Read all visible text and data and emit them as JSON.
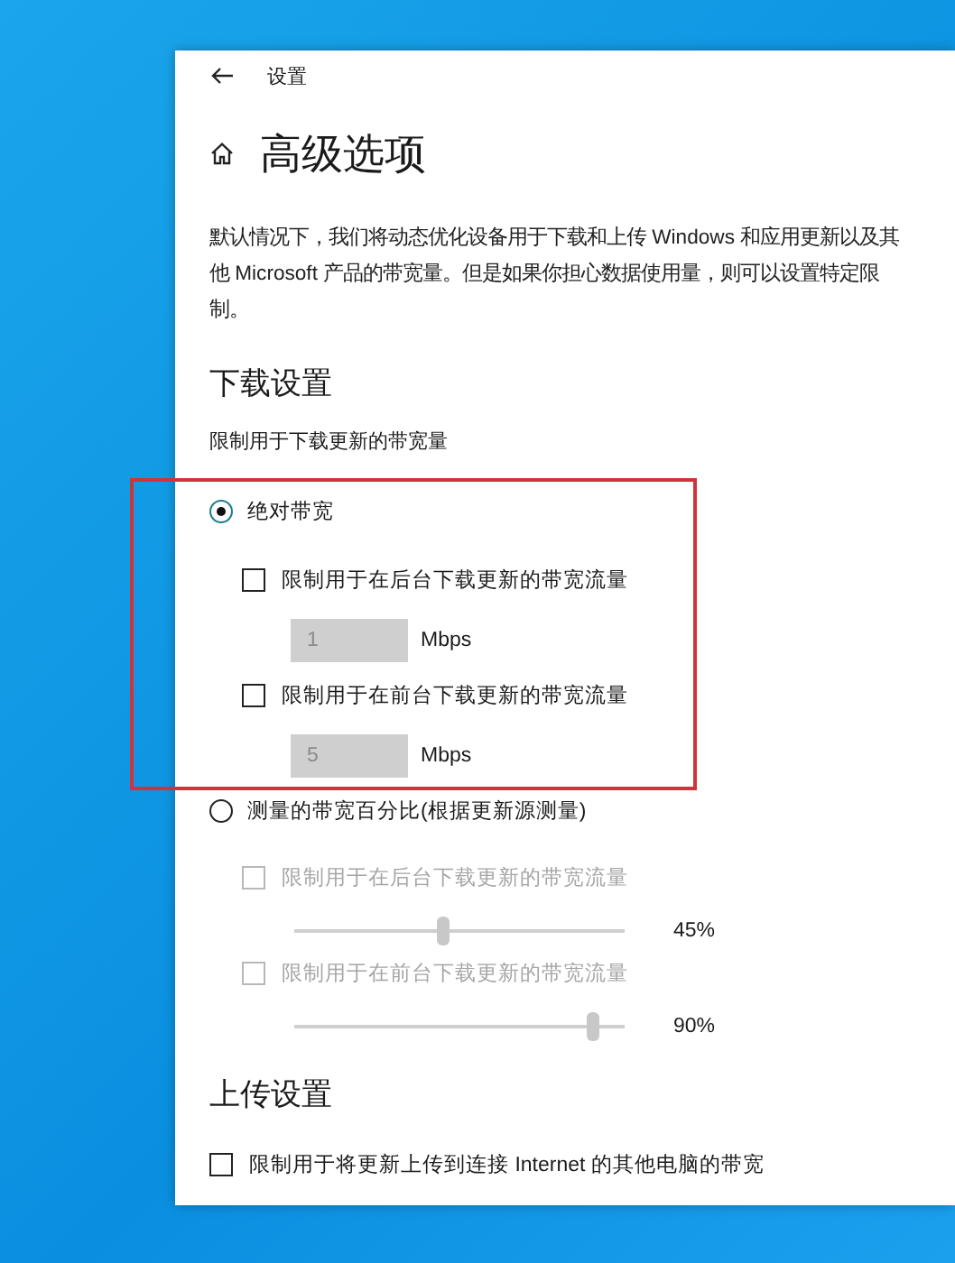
{
  "window": {
    "title": "设置"
  },
  "page": {
    "title": "高级选项",
    "description": "默认情况下，我们将动态优化设备用于下载和上传 Windows 和应用更新以及其他 Microsoft 产品的带宽量。但是如果你担心数据使用量，则可以设置特定限制。"
  },
  "download": {
    "heading": "下载设置",
    "subheading": "限制用于下载更新的带宽量",
    "options": [
      {
        "label": "绝对带宽",
        "selected": true,
        "limits": [
          {
            "kind": "field",
            "label": "限制用于在后台下载更新的带宽流量",
            "checked": false,
            "disabled": false,
            "value": "1",
            "unit": "Mbps"
          },
          {
            "kind": "field",
            "label": "限制用于在前台下载更新的带宽流量",
            "checked": false,
            "disabled": false,
            "value": "5",
            "unit": "Mbps"
          }
        ]
      },
      {
        "label": "测量的带宽百分比(根据更新源测量)",
        "selected": false,
        "limits": [
          {
            "kind": "slider",
            "label": "限制用于在后台下载更新的带宽流量",
            "checked": false,
            "disabled": true,
            "level": 0.45,
            "reading": "45%"
          },
          {
            "kind": "slider",
            "label": "限制用于在前台下载更新的带宽流量",
            "checked": false,
            "disabled": true,
            "level": 0.9,
            "reading": "90%"
          }
        ]
      }
    ]
  },
  "upload": {
    "heading": "上传设置",
    "limits": [
      {
        "label": "限制用于将更新上传到连接 Internet 的其他电脑的带宽",
        "checked": false,
        "disabled": false
      }
    ]
  },
  "annotation": {
    "kind": "highlight-frame"
  }
}
